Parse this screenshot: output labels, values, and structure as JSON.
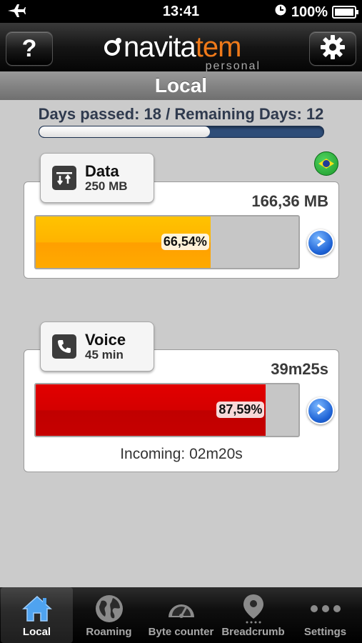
{
  "status_bar": {
    "time": "13:41",
    "battery": "100%"
  },
  "header": {
    "logo_main": "navita",
    "logo_accent": "tem",
    "logo_sub": "personal",
    "help_label": "?"
  },
  "title": "Local",
  "period": {
    "text": "Days passed: 18 / Remaining Days: 12",
    "days_passed": 18,
    "remaining_days": 12
  },
  "data_card": {
    "name": "Data",
    "quota": "250 MB",
    "used": "166,36 MB",
    "percent_label": "66,54%",
    "percent": 66.54,
    "color": "#ffb000"
  },
  "voice_card": {
    "name": "Voice",
    "quota": "45 min",
    "used": "39m25s",
    "percent_label": "87,59%",
    "percent": 87.59,
    "incoming": "Incoming: 02m20s",
    "color": "#d10000"
  },
  "tabs": [
    {
      "label": "Local",
      "icon": "home-icon",
      "active": true
    },
    {
      "label": "Roaming",
      "icon": "globe-icon",
      "active": false
    },
    {
      "label": "Byte counter",
      "icon": "speedometer-icon",
      "active": false
    },
    {
      "label": "Breadcrumb",
      "icon": "map-pin-icon",
      "active": false
    },
    {
      "label": "Settings",
      "icon": "more-icon",
      "active": false
    }
  ]
}
